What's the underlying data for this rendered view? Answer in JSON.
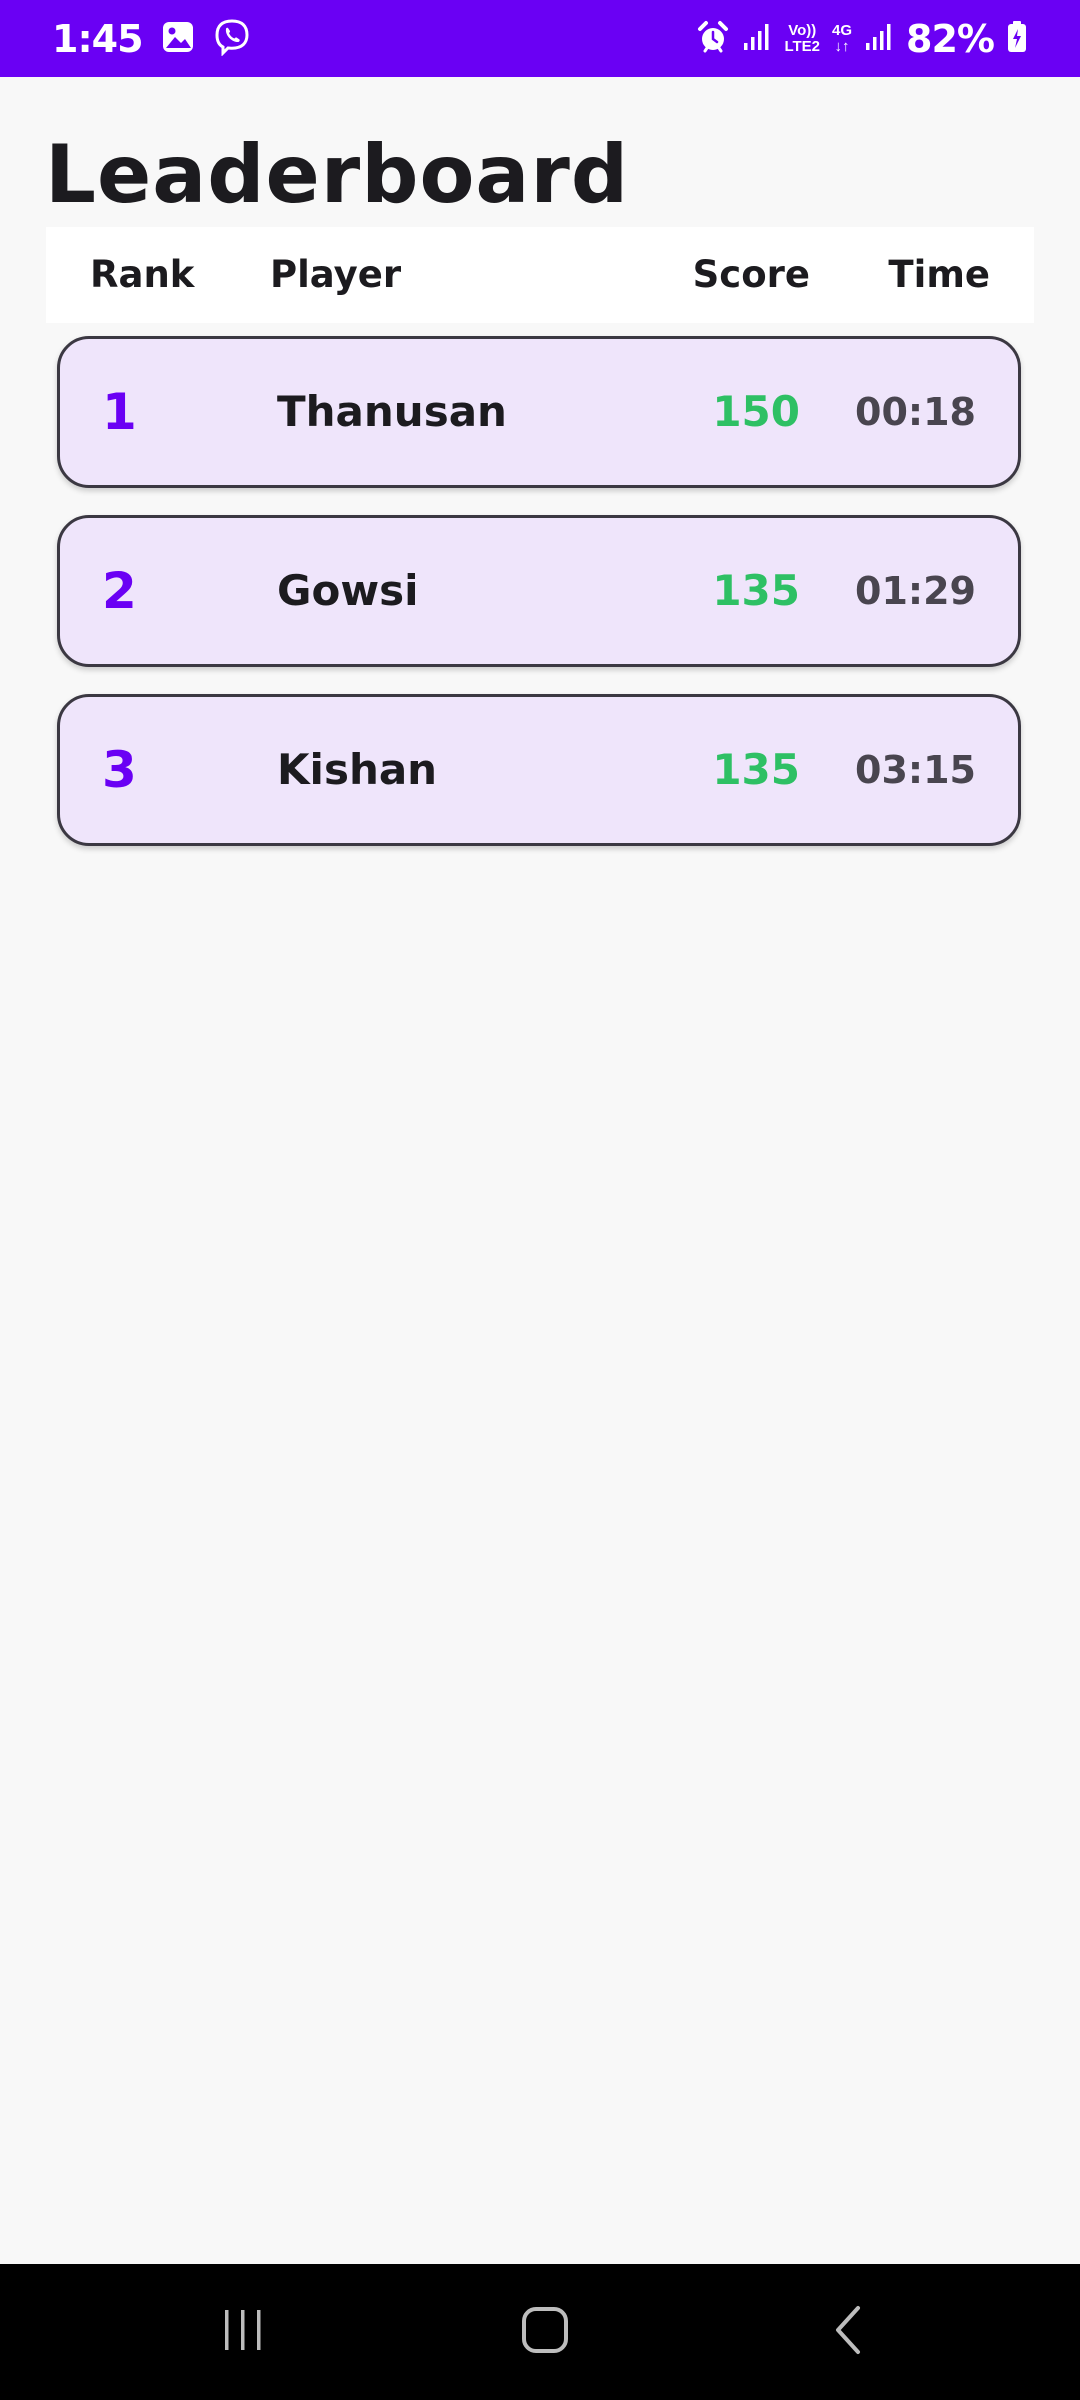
{
  "status_bar": {
    "time": "1:45",
    "battery": "82%",
    "network_vo": "Vo))",
    "network_lte": "LTE2",
    "network_4g": "4G"
  },
  "page": {
    "title": "Leaderboard"
  },
  "table": {
    "headers": {
      "rank": "Rank",
      "player": "Player",
      "score": "Score",
      "time": "Time"
    },
    "rows": [
      {
        "rank": "1",
        "player": "Thanusan",
        "score": "150",
        "time": "00:18"
      },
      {
        "rank": "2",
        "player": "Gowsi",
        "score": "135",
        "time": "01:29"
      },
      {
        "rank": "3",
        "player": "Kishan",
        "score": "135",
        "time": "03:15"
      }
    ]
  },
  "colors": {
    "accent": "#6a00f4",
    "score": "#2ec064",
    "card_background": "#efe5fb",
    "card_border": "#3b3842",
    "page_background": "#f8f8f8"
  },
  "icons": {
    "status_left": [
      "gallery-icon",
      "viber-icon"
    ],
    "status_right": [
      "alarm-icon",
      "signal-icon",
      "network-icon",
      "signal-icon",
      "battery-charging-icon"
    ],
    "navigation": [
      "recent-apps-icon",
      "home-icon",
      "back-icon"
    ]
  }
}
